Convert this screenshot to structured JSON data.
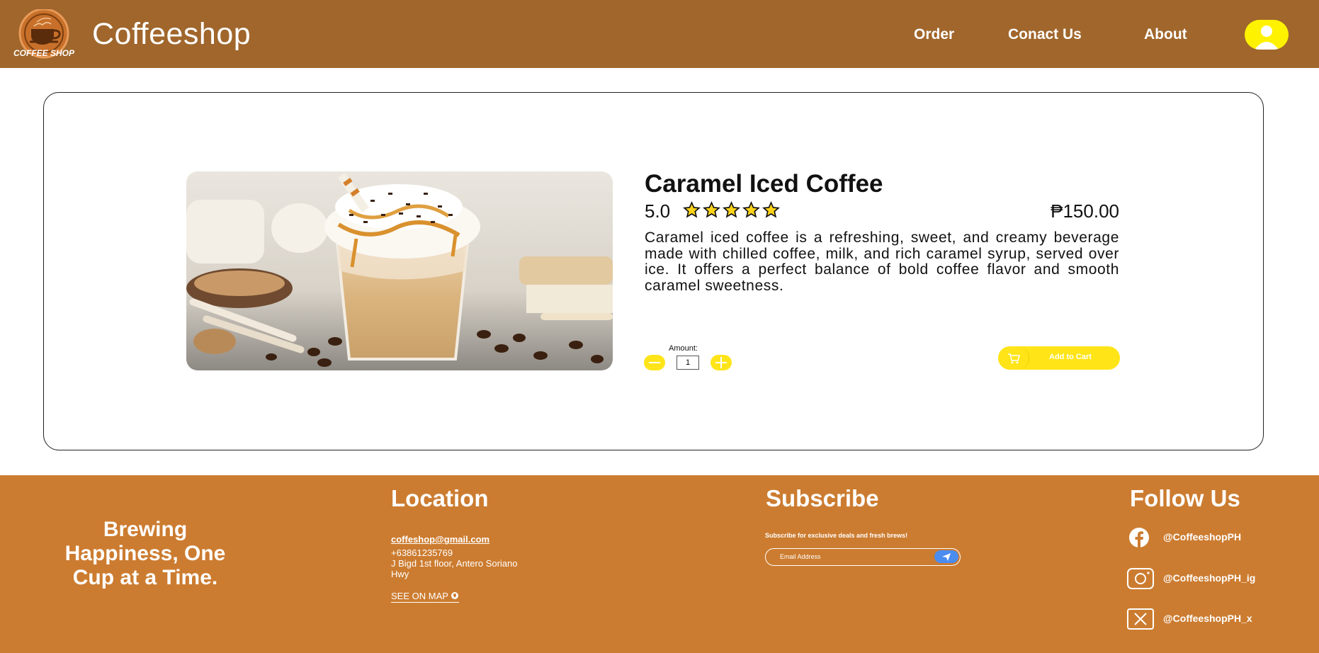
{
  "header": {
    "brand": "Coffeeshop",
    "logo_text": "COFFEE SHOP",
    "nav": [
      "Order",
      "Conact Us",
      "About"
    ]
  },
  "product": {
    "title": "Caramel Iced Coffee",
    "rating": "5.0",
    "stars": 5,
    "price": "₱150.00",
    "description": "Caramel iced coffee is a refreshing, sweet, and creamy beverage made with chilled coffee, milk, and rich caramel syrup, served over ice. It offers a perfect balance of bold coffee flavor and smooth caramel sweetness.",
    "amount_label": "Amount:",
    "quantity": "1",
    "add_to_cart": "Add to Cart"
  },
  "footer": {
    "tagline": "Brewing Happiness, One Cup at a Time.",
    "location": {
      "title": "Location",
      "email": "coffeshop@gmail.com",
      "phone": "+63861235769",
      "address_1": "J Bigd 1st floor, Antero Soriano",
      "address_2": "Hwy",
      "see_map": "SEE ON MAP"
    },
    "subscribe": {
      "title": "Subscribe",
      "text": "Subscribe for exclusive deals and fresh brews!",
      "placeholder": "Email Address"
    },
    "follow": {
      "title": "Follow Us",
      "facebook": "@CoffeeshopPH",
      "instagram": "@CoffeeshopPH_ig",
      "x": "@CoffeeshopPH_x"
    }
  },
  "colors": {
    "header": "#a0662c",
    "footer": "#cc7c30",
    "accent_yellow": "#ffe41a",
    "send_blue": "#4a8cf0"
  },
  "icons": [
    "coffee-cup-logo",
    "user-avatar-icon",
    "star-icon",
    "minus-icon",
    "plus-icon",
    "cart-icon",
    "send-icon",
    "map-pin-icon",
    "facebook-icon",
    "instagram-icon",
    "x-icon"
  ]
}
